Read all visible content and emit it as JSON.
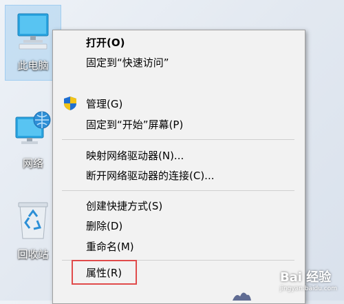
{
  "desktop": {
    "icons": [
      {
        "label": "此电脑",
        "selected": true
      },
      {
        "label": "网络",
        "selected": false
      },
      {
        "label": "回收站",
        "selected": false
      }
    ]
  },
  "context_menu": {
    "items": [
      {
        "label": "打开(O)",
        "bold": true
      },
      {
        "label": "固定到“快速访问”"
      },
      {
        "label": "管理(G)",
        "icon": "shield-icon"
      },
      {
        "label": "固定到“开始”屏幕(P)"
      },
      {
        "label": "映射网络驱动器(N)..."
      },
      {
        "label": "断开网络驱动器的连接(C)..."
      },
      {
        "label": "创建快捷方式(S)"
      },
      {
        "label": "删除(D)"
      },
      {
        "label": "重命名(M)"
      },
      {
        "label": "属性(R)",
        "highlighted": true
      }
    ],
    "highlight_color": "#e04a4a"
  },
  "watermark": {
    "text": "Bai 经验",
    "sub": "jingyan.baidu.com"
  }
}
